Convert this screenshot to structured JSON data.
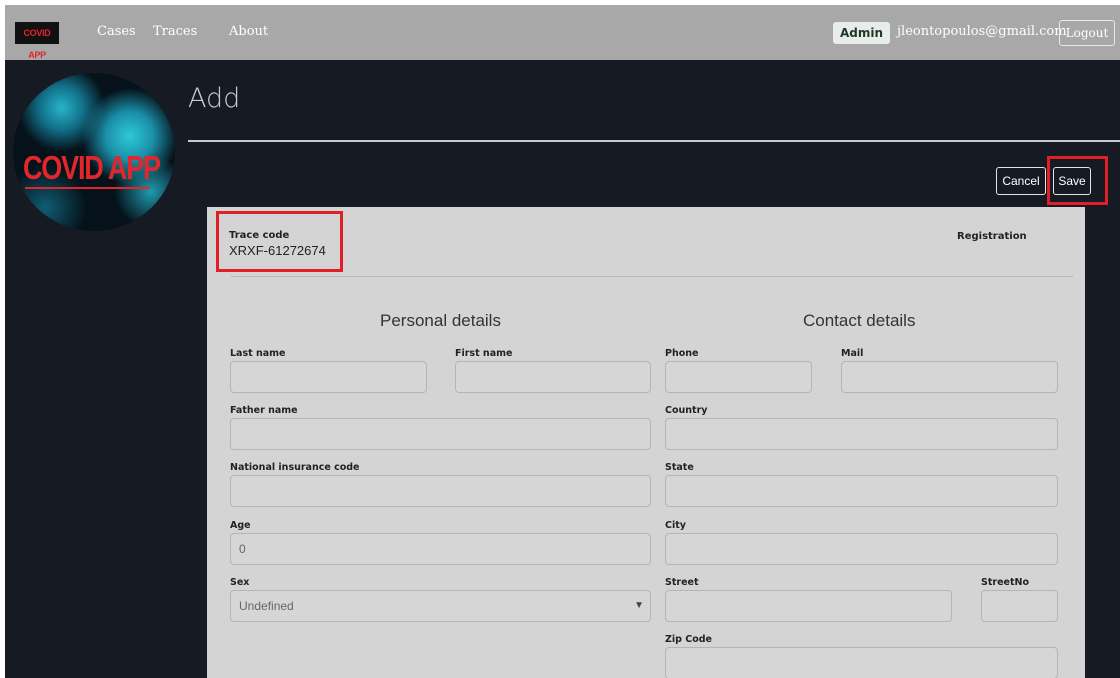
{
  "navbar": {
    "brand": "COVID APP",
    "links": [
      "Cases",
      "Traces",
      "About"
    ],
    "admin_badge": "Admin",
    "user_email": "jleontopoulos@gmail.com",
    "logout": "Logout"
  },
  "logo": {
    "text": "COVID APP"
  },
  "page": {
    "title": "Add"
  },
  "actions": {
    "cancel": "Cancel",
    "save": "Save"
  },
  "trace": {
    "label": "Trace code",
    "value": "XRXF-61272674",
    "registration": "Registration"
  },
  "personal": {
    "title": "Personal details",
    "last_name": "Last name",
    "first_name": "First name",
    "father_name": "Father name",
    "national_insurance_code": "National insurance code",
    "age_label": "Age",
    "age_value": "0",
    "sex_label": "Sex",
    "sex_value": "Undefined"
  },
  "contact": {
    "title": "Contact details",
    "phone": "Phone",
    "mail": "Mail",
    "country": "Country",
    "state": "State",
    "city": "City",
    "street": "Street",
    "street_no": "StreetNo",
    "zip_code": "Zip Code"
  },
  "colors": {
    "highlight": "#e11f26",
    "navbar": "#a8a8a8",
    "background": "#161a22",
    "card": "#d4d4d4",
    "brand_red": "#e3262b"
  },
  "icons": {
    "select": "chevron-down-icon"
  }
}
